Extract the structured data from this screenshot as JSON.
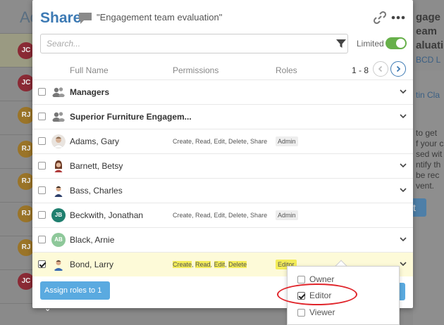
{
  "background": {
    "title_fragment": "Ac",
    "avatars": [
      "JC",
      "JC",
      "RJ",
      "RJ",
      "RJ",
      "RJ",
      "RJ",
      "RJ",
      "JC"
    ],
    "right_text": [
      "gage",
      "eam",
      "aluati",
      "BCD L",
      "tin Cla",
      "to get",
      "f your c",
      "sed wit",
      "ntify th",
      "be rec",
      "vent."
    ],
    "right_button_label": "t"
  },
  "dialog": {
    "title": "Share",
    "subject": "\"Engagement team evaluation\"",
    "search_placeholder": "Search...",
    "limited_label": "Limited",
    "limited_on": true,
    "columns": {
      "name": "Full Name",
      "permissions": "Permissions",
      "roles": "Roles"
    },
    "pager": "1 - 8",
    "rows": [
      {
        "name": "Managers",
        "type": "group",
        "permissions": "",
        "role": "",
        "checked": false
      },
      {
        "name": "Superior Furniture Engagem...",
        "type": "group",
        "permissions": "",
        "role": "",
        "checked": false
      },
      {
        "name": "Adams, Gary",
        "type": "photo",
        "permissions": "Create, Read, Edit, Delete, Share",
        "role": "Admin",
        "checked": false
      },
      {
        "name": "Barnett, Betsy",
        "type": "photo",
        "permissions": "",
        "role": "",
        "checked": false
      },
      {
        "name": "Bass, Charles",
        "type": "photo",
        "permissions": "",
        "role": "",
        "checked": false
      },
      {
        "name": "Beckwith, Jonathan",
        "type": "initials",
        "initials": "JB",
        "permissions": "Create, Read, Edit, Delete, Share",
        "role": "Admin",
        "checked": false
      },
      {
        "name": "Black, Arnie",
        "type": "initials",
        "initials": "AB",
        "permissions": "",
        "role": "",
        "checked": false
      },
      {
        "name": "Bond, Larry",
        "type": "photo",
        "permissions_parts": [
          "Create",
          "Read",
          "Edit",
          "Delete"
        ],
        "role": "Editor",
        "checked": true
      }
    ],
    "assign_button": "Assign roles to 1",
    "role_options": [
      {
        "label": "Owner",
        "checked": false
      },
      {
        "label": "Editor",
        "checked": true
      },
      {
        "label": "Viewer",
        "checked": false
      }
    ]
  },
  "colors": {
    "accent": "#3d7ab4",
    "toggle_on": "#67b04a",
    "highlight": "#f3ec58",
    "button": "#5aaae0",
    "annotation": "#e0242a"
  }
}
